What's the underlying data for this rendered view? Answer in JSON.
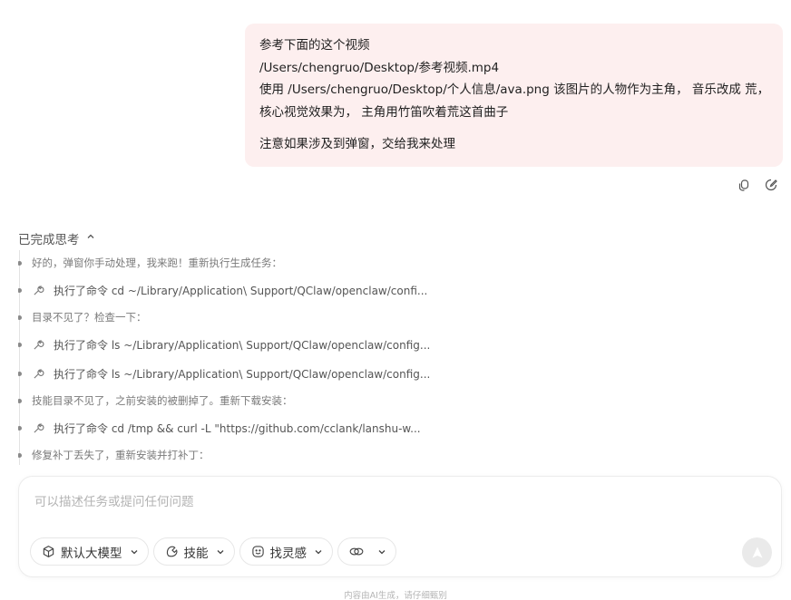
{
  "user_message": {
    "lines": [
      "参考下面的这个视频",
      "/Users/chengruo/Desktop/参考视频.mp4",
      "使用 /Users/chengruo/Desktop/个人信息/ava.png 该图片的人物作为主角， 音乐改成 荒，",
      "核心视觉效果为， 主角用竹笛吹着荒这首曲子"
    ],
    "note": "注意如果涉及到弹窗，交给我来处理",
    "actions": [
      {
        "name": "copy-icon"
      },
      {
        "name": "edit-icon"
      }
    ]
  },
  "thinking": {
    "header": "已完成思考",
    "icon": "chevron-up-icon",
    "items": [
      {
        "type": "note",
        "text": "好的，弹窗你手动处理，我来跑！重新执行生成任务："
      },
      {
        "type": "cmd",
        "icon": "wrench-icon",
        "text": "执行了命令 cd ~/Library/Application\\ Support/QClaw/openclaw/confi..."
      },
      {
        "type": "note",
        "text": "目录不见了？检查一下："
      },
      {
        "type": "cmd",
        "icon": "wrench-icon",
        "text": "执行了命令 ls ~/Library/Application\\ Support/QClaw/openclaw/config..."
      },
      {
        "type": "cmd",
        "icon": "wrench-icon",
        "text": "执行了命令 ls ~/Library/Application\\ Support/QClaw/openclaw/config..."
      },
      {
        "type": "note",
        "text": "技能目录不见了，之前安装的被删掉了。重新下载安装："
      },
      {
        "type": "cmd",
        "icon": "wrench-icon",
        "text": "执行了命令 cd /tmp && curl -L \"https://github.com/cclank/lanshu-w..."
      },
      {
        "type": "note",
        "text": "修复补丁丢失了，重新安装并打补丁："
      }
    ]
  },
  "composer": {
    "placeholder": "可以描述任务或提问任何问题",
    "value": "",
    "toolbar": {
      "model_label": "默认大模型",
      "skills_label": "技能",
      "inspire_label": "找灵感"
    }
  },
  "footer_note": "内容由AI生成，请仔细甄别"
}
